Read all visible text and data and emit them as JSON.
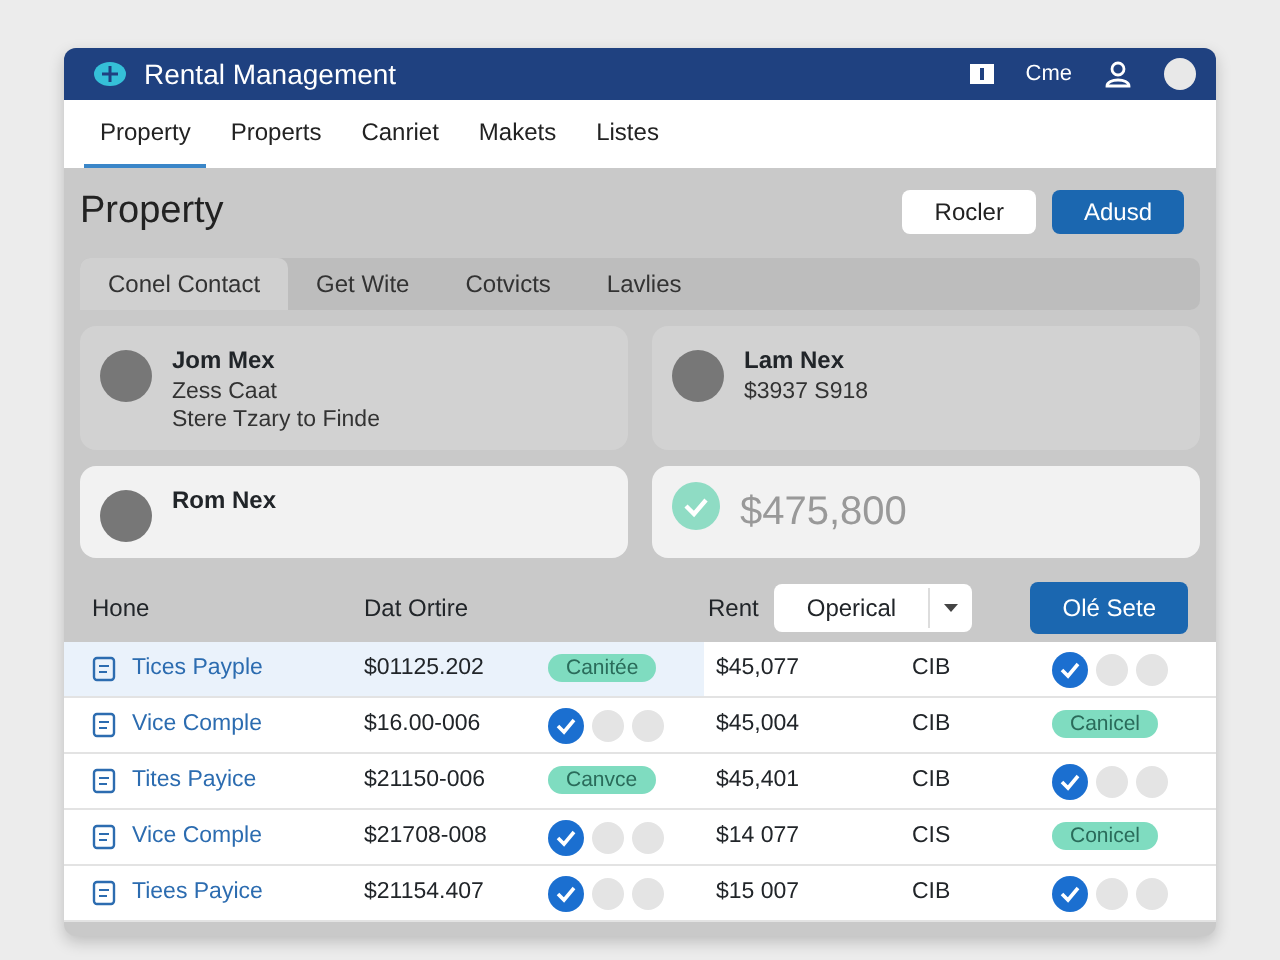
{
  "header": {
    "title": "Rental Management",
    "user_label": "Cme"
  },
  "nav_tabs": [
    {
      "label": "Property",
      "selected": true
    },
    {
      "label": "Properts",
      "selected": false
    },
    {
      "label": "Canriet",
      "selected": false
    },
    {
      "label": "Makets",
      "selected": false
    },
    {
      "label": "Listes",
      "selected": false
    }
  ],
  "page_title": "Property",
  "actions": [
    {
      "label": "Rocler",
      "kind": "secondary"
    },
    {
      "label": "Adusd",
      "kind": "primary"
    }
  ],
  "sub_tabs": [
    {
      "label": "Conel Contact",
      "selected": true
    },
    {
      "label": "Get Wite",
      "selected": false
    },
    {
      "label": "Cotvicts",
      "selected": false
    },
    {
      "label": "Lavlies",
      "selected": false
    }
  ],
  "cards": [
    {
      "kind": "person",
      "lines": [
        "Jom Mex",
        "Zess Caat",
        "Stere Tzary to Finde"
      ]
    },
    {
      "kind": "person",
      "lines": [
        "Lam Nex",
        "$3937 S918"
      ]
    },
    {
      "kind": "person",
      "lines": [
        "Rom Nex"
      ]
    },
    {
      "kind": "check",
      "lines": [
        "$475,800"
      ]
    }
  ],
  "table": {
    "columns": [
      "Hone",
      "Dat Ortire",
      "Rent"
    ],
    "filter": {
      "value": "Operical"
    },
    "action": "Olé Sete",
    "rows": [
      {
        "selected": true,
        "name": "Tices Payple",
        "date": "$01125.202",
        "col_3": {
          "kind": "badge",
          "text": "Canitée"
        },
        "rent": "$45,077",
        "code": "CIB",
        "col_6": {
          "kind": "toggles",
          "checked": true
        }
      },
      {
        "selected": false,
        "name": "Vice Comple",
        "date": "$16.00-006",
        "col_3": {
          "kind": "toggles",
          "checked": true
        },
        "rent": "$45,004",
        "code": "CIB",
        "col_6": {
          "kind": "badge",
          "text": "Canicel"
        }
      },
      {
        "selected": false,
        "name": "Tites Payice",
        "date": "$21150-006",
        "col_3": {
          "kind": "badge",
          "text": "Canvce"
        },
        "rent": "$45,401",
        "code": "CIB",
        "col_6": {
          "kind": "toggles",
          "checked": true
        }
      },
      {
        "selected": false,
        "name": "Vice Comple",
        "date": "$21708-008",
        "col_3": {
          "kind": "toggles",
          "checked": true
        },
        "rent": "$14 077",
        "code": "CIS",
        "col_6": {
          "kind": "badge",
          "text": "Conicel"
        }
      },
      {
        "selected": false,
        "name": "Tiees Payice",
        "date": "$21154.407",
        "col_3": {
          "kind": "toggles",
          "checked": true
        },
        "rent": "$15 007",
        "code": "CIB",
        "col_6": {
          "kind": "toggles",
          "checked": true
        }
      }
    ]
  }
}
